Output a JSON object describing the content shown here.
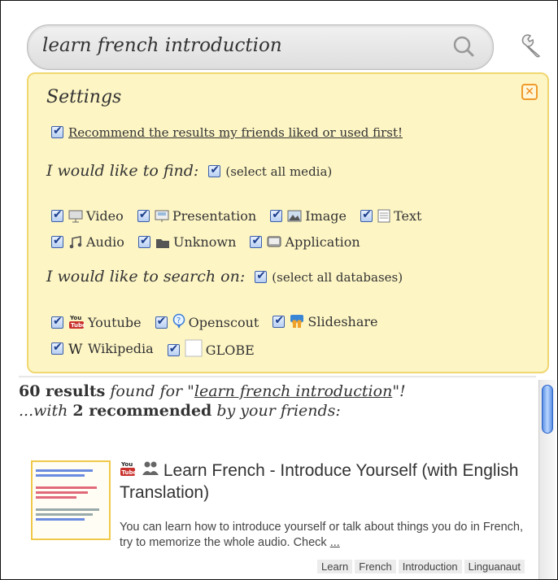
{
  "search": {
    "query": "learn french introduction"
  },
  "settings": {
    "title": "Settings",
    "recommend_label": "Recommend the results my friends liked or used first!",
    "find_heading": "I would like to find:",
    "select_all_media": "(select all media)",
    "media": [
      {
        "label": "Video",
        "icon": "video-icon"
      },
      {
        "label": "Presentation",
        "icon": "presentation-icon"
      },
      {
        "label": "Image",
        "icon": "image-icon"
      },
      {
        "label": "Text",
        "icon": "text-icon"
      },
      {
        "label": "Audio",
        "icon": "audio-icon"
      },
      {
        "label": "Unknown",
        "icon": "folder-icon"
      },
      {
        "label": "Application",
        "icon": "application-icon"
      }
    ],
    "search_on_heading": "I would like to search on:",
    "select_all_databases": "(select all databases)",
    "databases": [
      {
        "label": "Youtube",
        "icon": "youtube-icon"
      },
      {
        "label": "Openscout",
        "icon": "openscout-icon"
      },
      {
        "label": "Slideshare",
        "icon": "slideshare-icon"
      },
      {
        "label": "Wikipedia",
        "icon": "wikipedia-icon"
      },
      {
        "label": "GLOBE",
        "icon": "globe-icon"
      }
    ]
  },
  "results": {
    "count": "60 results",
    "found_for": " found for \"",
    "query": "learn french introduction",
    "after_query": "\"!",
    "line2_pre": "...with ",
    "recommended": "2 recommended",
    "line2_post": " by your friends:",
    "items": [
      {
        "title": "Learn French - Introduce Yourself (with English Translation)",
        "description": "You can learn how to introduce yourself or talk about things you do in French, try to memorize the whole audio. Check ",
        "more": "...",
        "tags": [
          "Learn",
          "French",
          "Introduction",
          "Linguanaut"
        ]
      }
    ]
  },
  "colors": {
    "panel": "#fdf5c4",
    "panel_border": "#f0d770",
    "close": "#ef8a18",
    "scroll_thumb": "#5a8fe4"
  }
}
